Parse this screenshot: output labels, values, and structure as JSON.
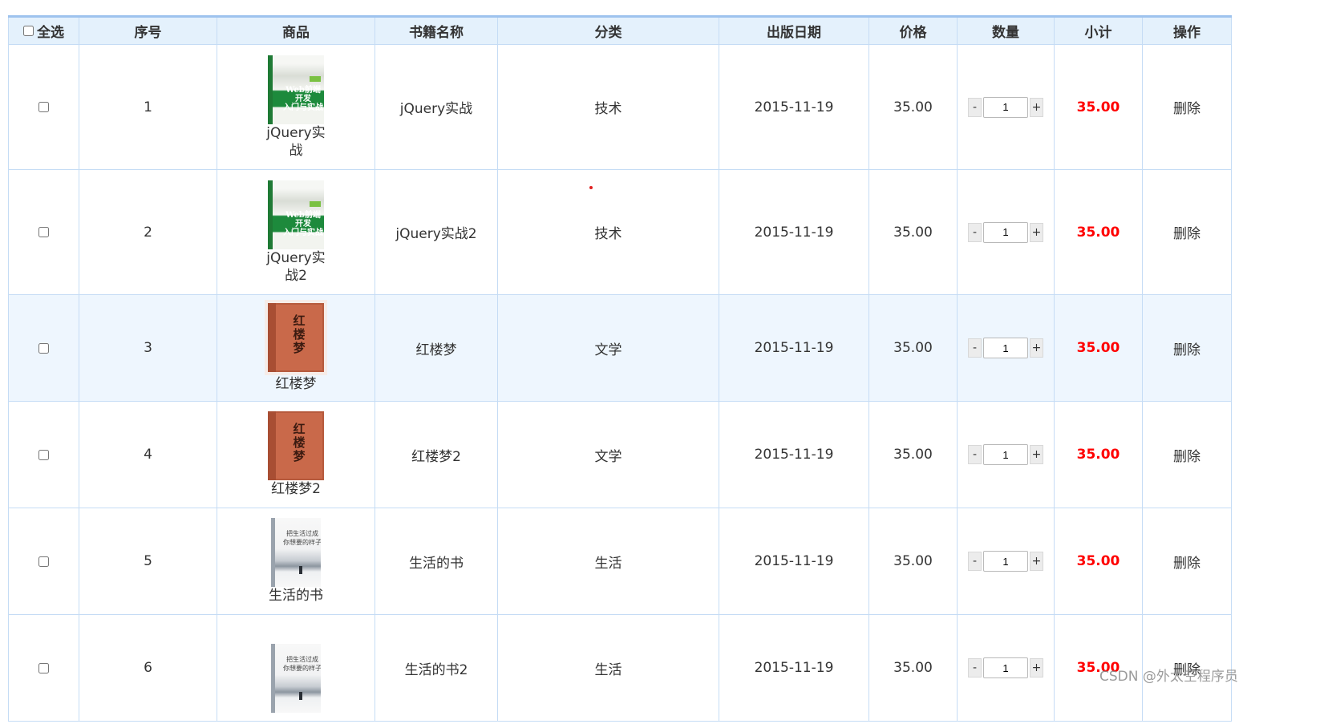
{
  "header": {
    "select_all": "全选",
    "index": "序号",
    "product": "商品",
    "book_name": "书籍名称",
    "category": "分类",
    "publish_date": "出版日期",
    "price": "价格",
    "quantity": "数量",
    "subtotal": "小计",
    "action": "操作"
  },
  "rows": [
    {
      "index": "1",
      "cover": "jquery-book-cover",
      "product_name": "jQuery实战",
      "book_name": "jQuery实战",
      "category": "技术",
      "date": "2015-11-19",
      "price": "35.00",
      "qty": "1",
      "minus": "-",
      "plus": "+",
      "subtotal": "35.00",
      "action": "删除"
    },
    {
      "index": "2",
      "cover": "jquery-book-cover",
      "product_name": "jQuery实战2",
      "book_name": "jQuery实战2",
      "category": "技术",
      "date": "2015-11-19",
      "price": "35.00",
      "qty": "1",
      "minus": "-",
      "plus": "+",
      "subtotal": "35.00",
      "action": "删除"
    },
    {
      "index": "3",
      "cover": "hongloumeng-book-cover",
      "product_name": "红楼梦",
      "book_name": "红楼梦",
      "category": "文学",
      "date": "2015-11-19",
      "price": "35.00",
      "qty": "1",
      "minus": "-",
      "plus": "+",
      "subtotal": "35.00",
      "action": "删除"
    },
    {
      "index": "4",
      "cover": "hongloumeng-book-cover",
      "product_name": "红楼梦2",
      "book_name": "红楼梦2",
      "category": "文学",
      "date": "2015-11-19",
      "price": "35.00",
      "qty": "1",
      "minus": "-",
      "plus": "+",
      "subtotal": "35.00",
      "action": "删除"
    },
    {
      "index": "5",
      "cover": "life-book-cover",
      "product_name": "生活的书",
      "book_name": "生活的书",
      "category": "生活",
      "date": "2015-11-19",
      "price": "35.00",
      "qty": "1",
      "minus": "-",
      "plus": "+",
      "subtotal": "35.00",
      "action": "删除"
    },
    {
      "index": "6",
      "cover": "life-book-cover",
      "product_name": "",
      "book_name": "生活的书2",
      "category": "生活",
      "date": "2015-11-19",
      "price": "35.00",
      "qty": "1",
      "minus": "-",
      "plus": "+",
      "subtotal": "35.00",
      "action": "删除"
    }
  ],
  "watermark": "CSDN @外太空程序员",
  "colors": {
    "header_bg": "#e4f1fc",
    "border": "#c5dcf5",
    "subtotal": "#ff0000",
    "hover_row": "#eef6fe"
  }
}
